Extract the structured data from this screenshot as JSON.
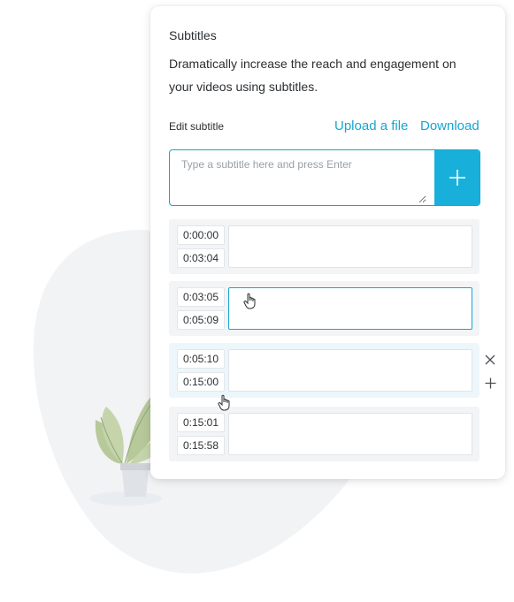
{
  "card": {
    "title": "Subtitles",
    "description": "Dramatically increase the reach and engagement on your videos using subtitles."
  },
  "editor": {
    "label": "Edit subtitle",
    "upload_link": "Upload a file",
    "download_link": "Download",
    "input_placeholder": "Type a subtitle here and press Enter",
    "add_icon": "plus-icon"
  },
  "rows": [
    {
      "start": "0:00:00",
      "end": "0:03:04",
      "text": ""
    },
    {
      "start": "0:03:05",
      "end": "0:05:09",
      "text": ""
    },
    {
      "start": "0:05:10",
      "end": "0:15:00",
      "text": ""
    },
    {
      "start": "0:15:01",
      "end": "0:15:58",
      "text": ""
    }
  ],
  "row_actions": {
    "remove_icon": "close-icon",
    "insert_icon": "plus-icon"
  },
  "colors": {
    "accent": "#18a5d0",
    "accent_button": "#18b0db",
    "row_bg": "#f2f4f6",
    "blob": "#f2f3f5",
    "leaf": "#b7c99a"
  }
}
